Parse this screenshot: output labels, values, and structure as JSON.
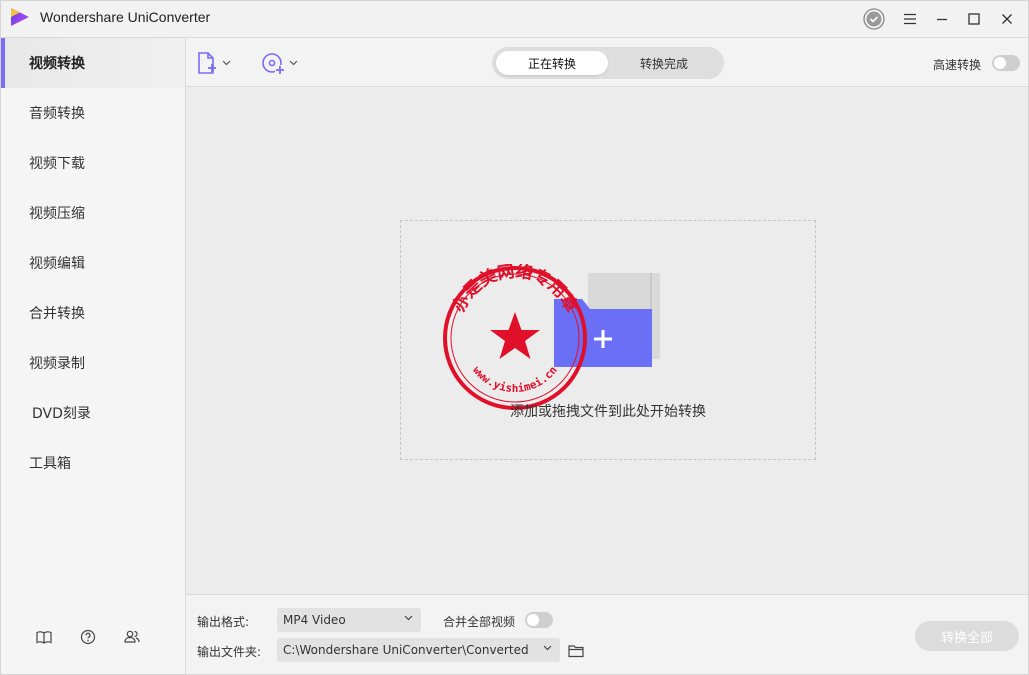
{
  "window": {
    "title": "Wondershare UniConverter"
  },
  "sidebar": {
    "items": [
      {
        "label": "视频转换",
        "active": true
      },
      {
        "label": "音频转换"
      },
      {
        "label": "视频下载"
      },
      {
        "label": "视频压缩"
      },
      {
        "label": "视频编辑"
      },
      {
        "label": "合并转换"
      },
      {
        "label": "视频录制"
      },
      {
        "label": "DVD刻录"
      },
      {
        "label": "工具箱"
      }
    ],
    "bottom_icons": [
      "book-icon",
      "help-icon",
      "users-icon"
    ]
  },
  "toolbar": {
    "tabs": [
      {
        "label": "正在转换",
        "active": true
      },
      {
        "label": "转换完成"
      }
    ],
    "high_speed_label": "高速转换",
    "add_file_icon": "add-file-icon",
    "add_disc_icon": "add-disc-icon"
  },
  "main": {
    "drop_text": "添加或拖拽文件到此处开始转换"
  },
  "stamp": {
    "arc_text": "亦是美网络专用章",
    "bottom_text": "www.yishimei.cn",
    "color": "#e0102a"
  },
  "footer": {
    "format_label": "输出格式:",
    "format_value": "MP4 Video",
    "merge_label": "合并全部视频",
    "folder_label": "输出文件夹:",
    "folder_value": "C:\\Wondershare UniConverter\\Converted",
    "convert_all_label": "转换全部"
  },
  "colors": {
    "accent": "#7b6cf6",
    "folder_front": "#6a6ff5",
    "folder_back": "#d9d9d9"
  }
}
